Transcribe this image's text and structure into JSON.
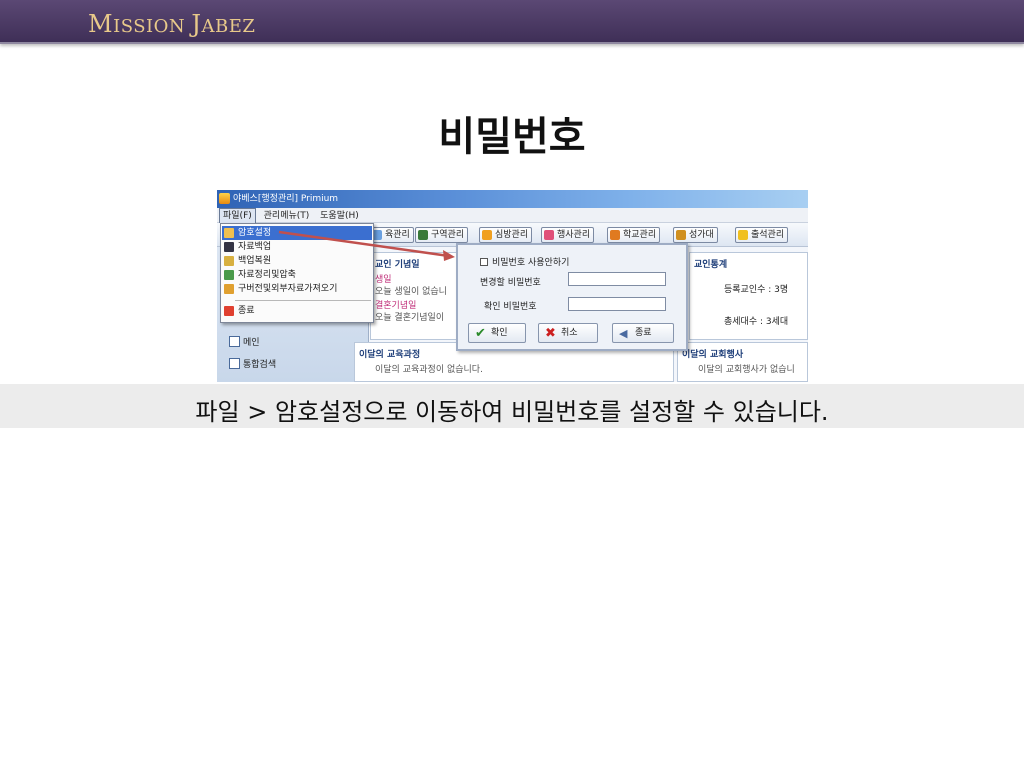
{
  "header": {
    "brand_first_big": "M",
    "brand_first_rest": "ISSION",
    "brand_second_big": "J",
    "brand_second_rest": "ABEZ"
  },
  "slide": {
    "title": "비밀번호",
    "caption": "파일 > 암호설정으로 이동하여 비밀번호를 설정할 수 있습니다."
  },
  "app": {
    "window_title": "야베스[행정관리]  Primium",
    "menu": [
      "파일(F)",
      "관리메뉴(T)",
      "도움말(H)"
    ],
    "toolbar": [
      "육관리",
      "구역관리",
      "심방관리",
      "행사관리",
      "학교관리",
      "성가대",
      "출석관리"
    ],
    "file_menu": [
      "암호설정",
      "자료백업",
      "백업복원",
      "자료정리및압축",
      "구버전및외부자료가져오기",
      "종료"
    ],
    "sidebar": [
      "메인",
      "통합검색"
    ],
    "anniversary": {
      "title": "교인 기념일",
      "birthday_label": "생일",
      "birthday_text": "오늘 생일이 없습니",
      "wedding_label": "결혼기념일",
      "wedding_text": "오늘 결혼기념일이"
    },
    "stats": {
      "title": "교인통계",
      "members": "등록교인수 : 3명",
      "households": "총세대수 : 3세대"
    },
    "courses": {
      "title": "이달의 교육과정",
      "text": "이달의 교육과정이 없습니다."
    },
    "events": {
      "title": "이달의 교회행사",
      "text": "이달의 교회행사가 없습니"
    },
    "dialog": {
      "disable_password": "비밀번호 사용안하기",
      "new_password_label": "변경할 비밀번호",
      "confirm_password_label": "확인 비밀번호",
      "ok": "확인",
      "cancel": "취소",
      "exit": "종료"
    }
  },
  "colors": {
    "header_bg": "#4a3a63",
    "brand": "#e8c98a",
    "arrow": "#c0504d",
    "highlight": "#3b6fd0"
  }
}
